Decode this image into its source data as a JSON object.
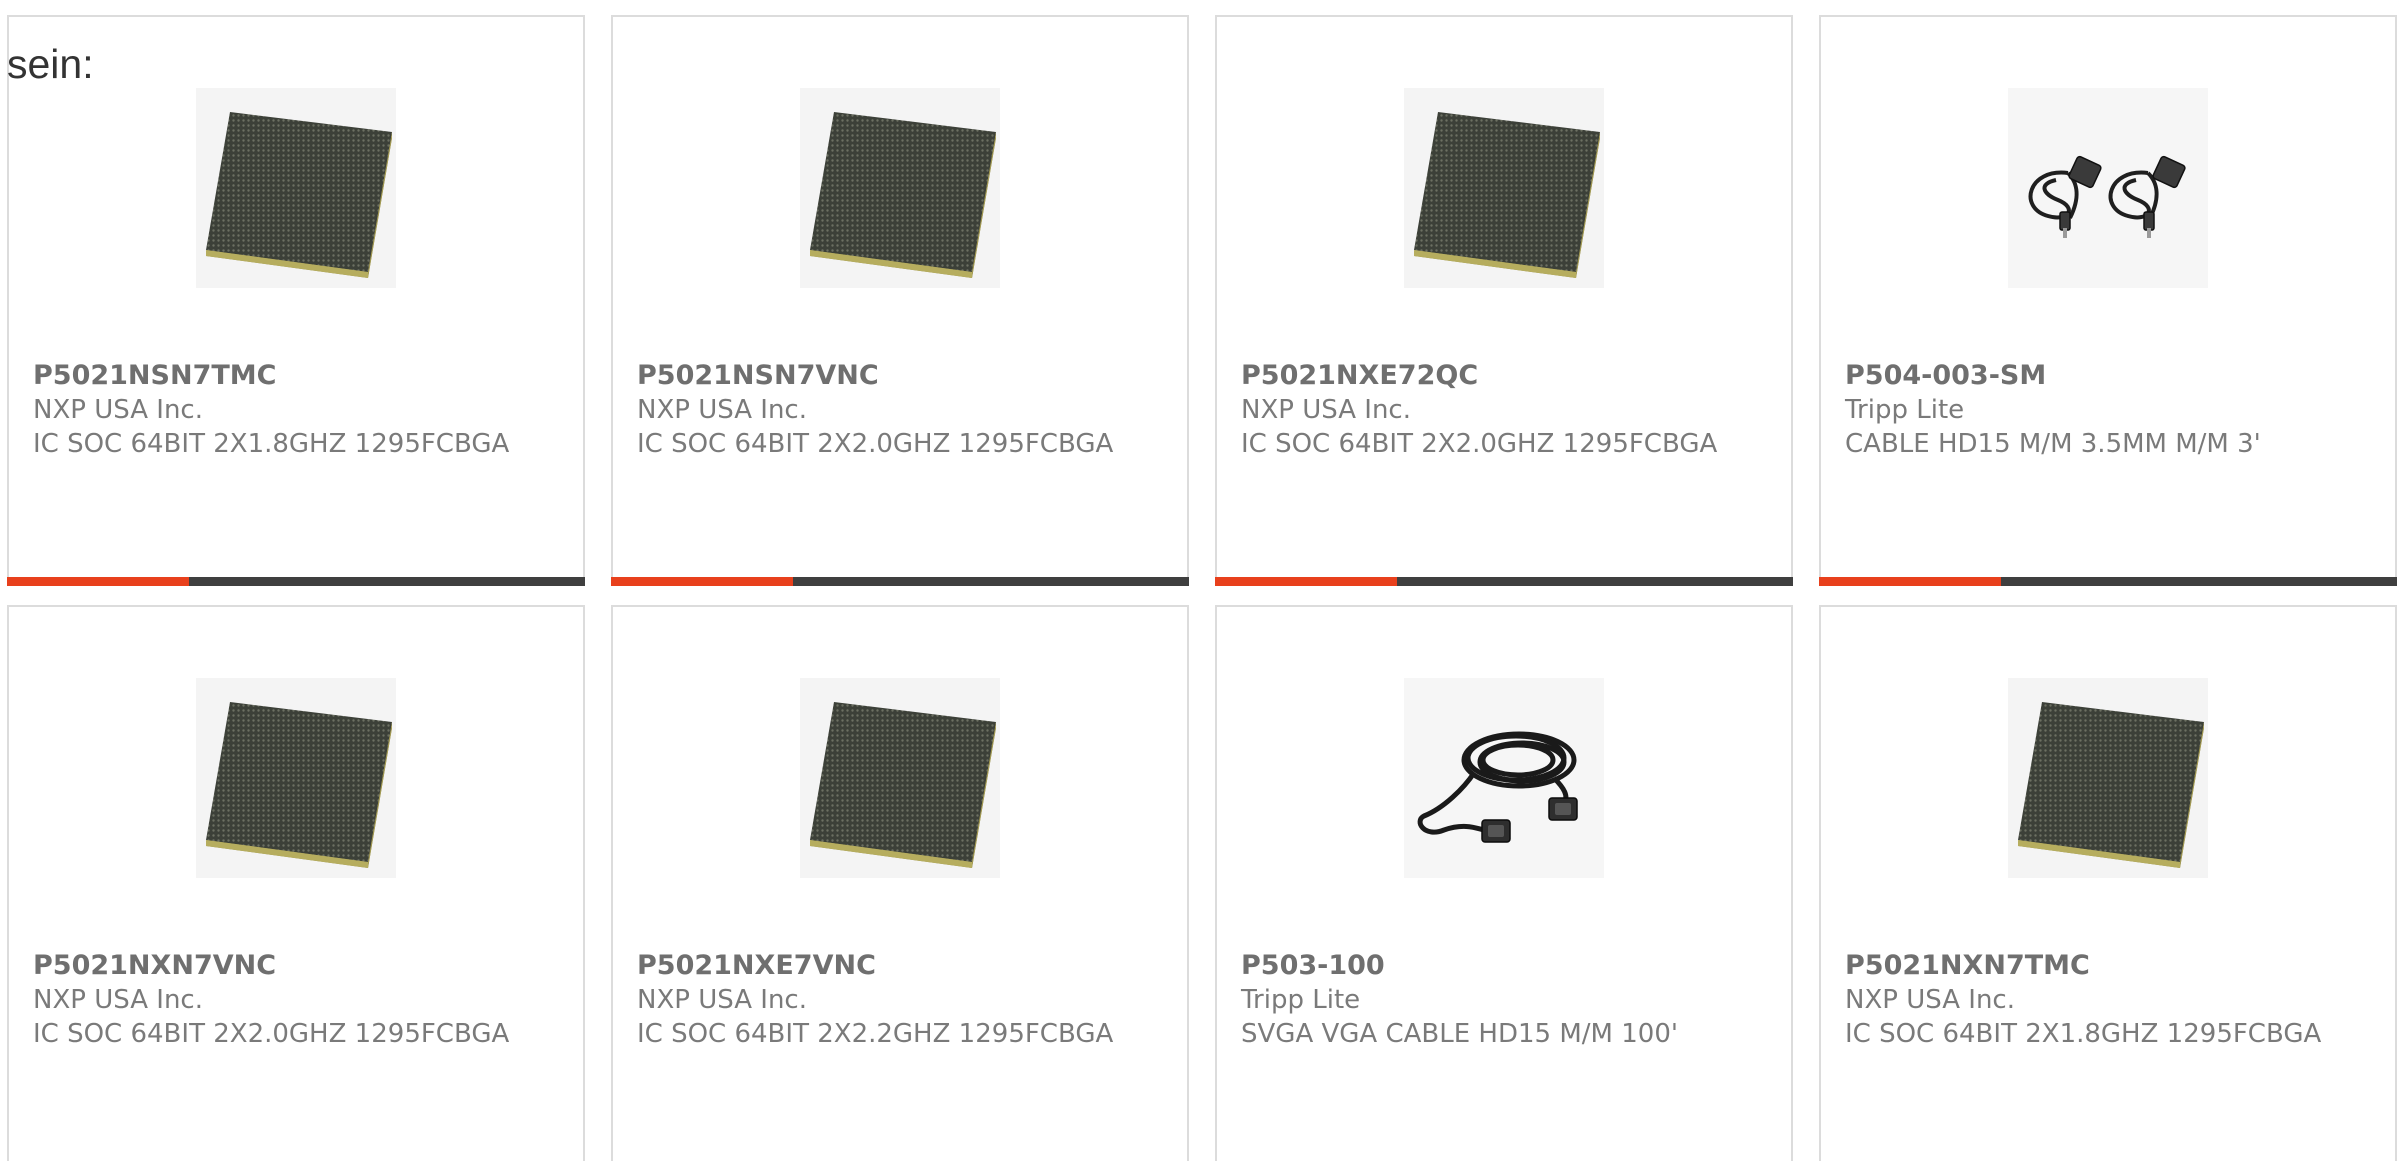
{
  "intro": {
    "label": "sein:"
  },
  "colors": {
    "accent": "#e8401c",
    "bar": "#3f3f3f",
    "border": "#dcdcdc",
    "text": "#7a7a7a"
  },
  "products": [
    {
      "part": "P5021NSN7TMC",
      "maker": "NXP USA Inc.",
      "desc": "IC SOC 64BIT 2X1.8GHZ 1295FCBGA",
      "image": "chip-image"
    },
    {
      "part": "P5021NSN7VNC",
      "maker": "NXP USA Inc.",
      "desc": "IC SOC 64BIT 2X2.0GHZ 1295FCBGA",
      "image": "chip-image"
    },
    {
      "part": "P5021NXE72QC",
      "maker": "NXP USA Inc.",
      "desc": "IC SOC 64BIT 2X2.0GHZ 1295FCBGA",
      "image": "chip-image"
    },
    {
      "part": "P504-003-SM",
      "maker": "Tripp Lite",
      "desc": "CABLE HD15 M/M 3.5MM M/M 3'",
      "image": "cable-pair-image"
    },
    {
      "part": "P5021NXN7VNC",
      "maker": "NXP USA Inc.",
      "desc": "IC SOC 64BIT 2X2.0GHZ 1295FCBGA",
      "image": "chip-image"
    },
    {
      "part": "P5021NXE7VNC",
      "maker": "NXP USA Inc.",
      "desc": "IC SOC 64BIT 2X2.2GHZ 1295FCBGA",
      "image": "chip-image"
    },
    {
      "part": "P503-100",
      "maker": "Tripp Lite",
      "desc": "SVGA VGA CABLE HD15 M/M 100'",
      "image": "cable-coil-image"
    },
    {
      "part": "P5021NXN7TMC",
      "maker": "NXP USA Inc.",
      "desc": "IC SOC 64BIT 2X1.8GHZ 1295FCBGA",
      "image": "chip-image"
    }
  ]
}
